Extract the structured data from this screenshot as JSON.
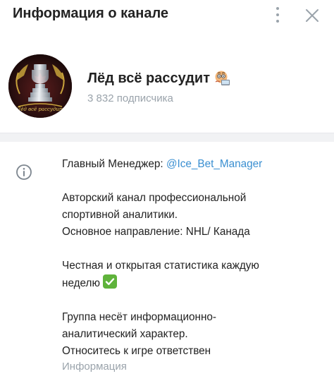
{
  "header": {
    "title": "Информация о канале",
    "more_icon": "more-vertical-icon",
    "close_icon": "close-icon"
  },
  "channel": {
    "name": "Лёд всё рассудит",
    "name_emoji": "nerd-face-laptop-emoji",
    "subscribers": "3 832 подписчика",
    "avatar_text": "Лёд всё рассудит"
  },
  "info": {
    "icon": "info-icon",
    "manager_label": "Главный Менеджер: ",
    "manager_link": "@Ice_Bet_Manager",
    "line_1": "Авторский канал профессиональной",
    "line_2": "спортивной аналитики.",
    "line_3": "Основное направление: NHL/ Канада",
    "line_4": "Честная и открытая статистика каждую",
    "line_5": "неделю",
    "line_5_emoji": "check-mark-button-emoji",
    "line_6": "Группа несёт информационно-",
    "line_7": "аналитический характер.",
    "line_8": "Относитесь к игре ответствен",
    "caption": "Информация"
  },
  "colors": {
    "accent_link": "#3a8fd1",
    "secondary_text": "#9aa3ab",
    "primary_text": "#222222",
    "check_green": "#5fb33b"
  }
}
